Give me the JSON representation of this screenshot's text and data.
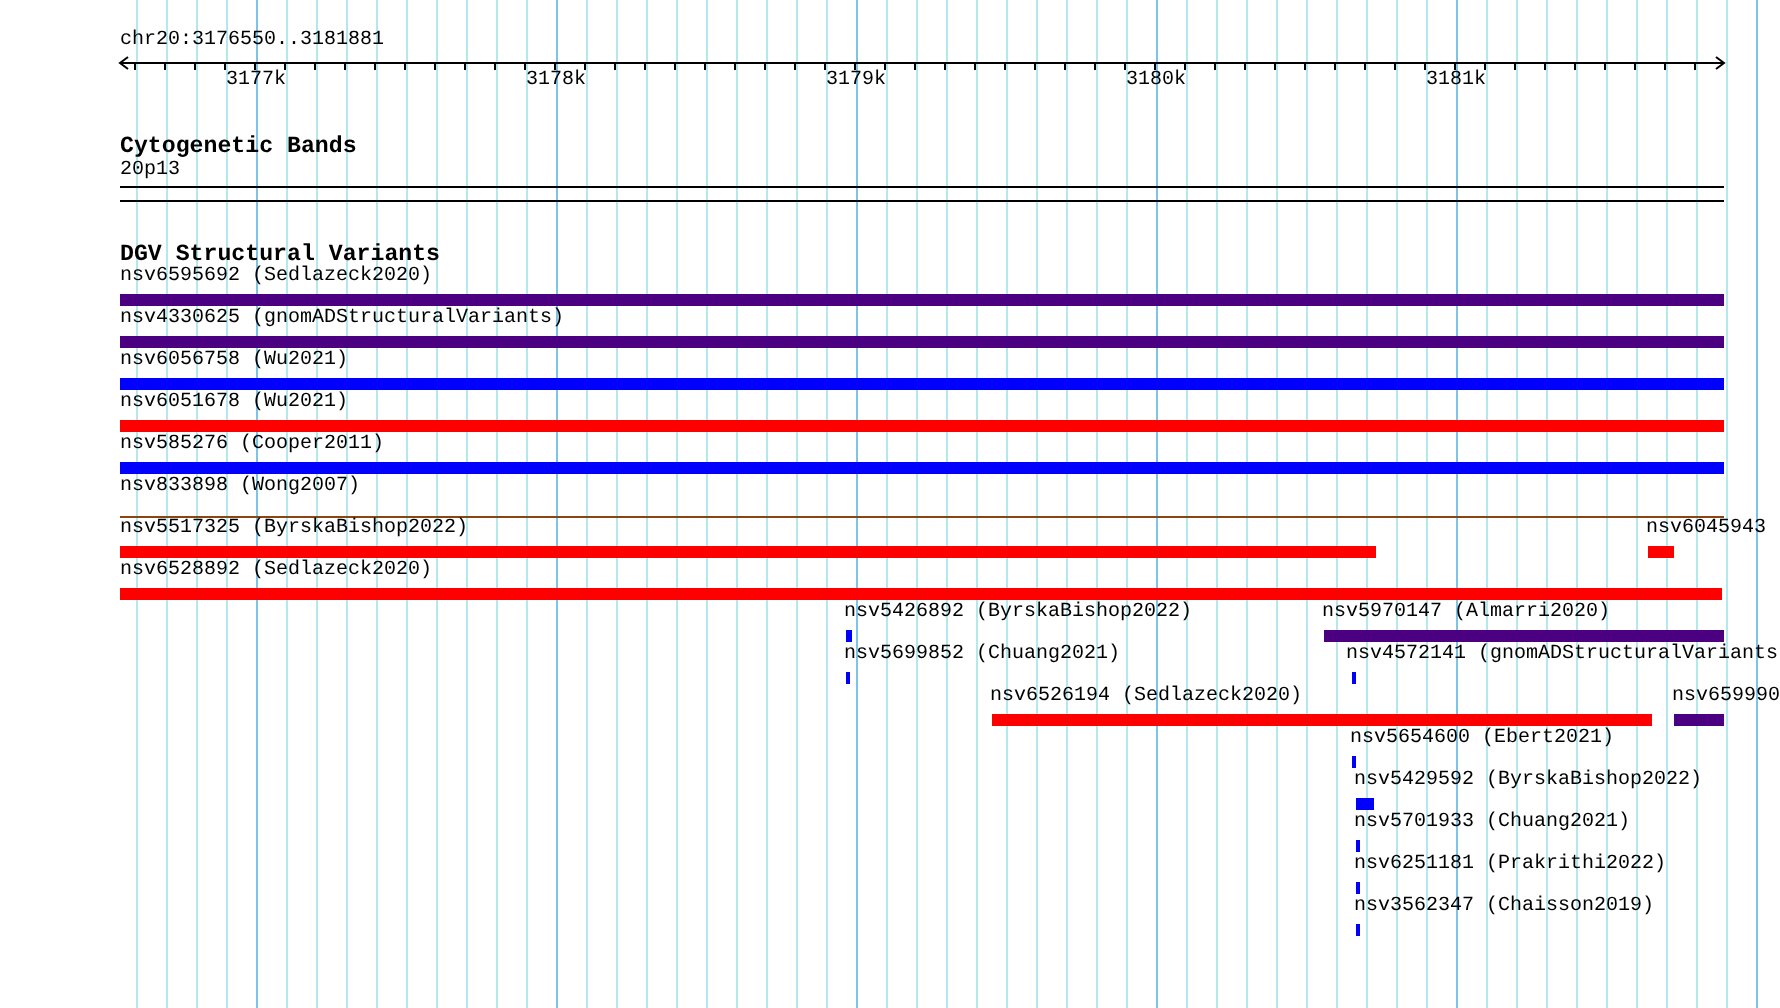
{
  "ruler": {
    "location": "chr20:3176550..3181881",
    "ticks": [
      "3177k",
      "3178k",
      "3179k",
      "3180k",
      "3181k"
    ]
  },
  "cytobands": {
    "title": "Cytogenetic Bands",
    "band": "20p13"
  },
  "variants": {
    "title": "DGV Structural Variants",
    "rows": [
      {
        "features": [
          {
            "label": "nsv6595692 (Sedlazeck2020)",
            "color": "#4b0082",
            "kind": "bar"
          }
        ]
      },
      {
        "features": [
          {
            "label": "nsv4330625 (gnomADStructuralVariants)",
            "color": "#4b0082",
            "kind": "bar"
          }
        ]
      },
      {
        "features": [
          {
            "label": "nsv6056758 (Wu2021)",
            "color": "#0000ff",
            "kind": "bar"
          }
        ]
      },
      {
        "features": [
          {
            "label": "nsv6051678 (Wu2021)",
            "color": "#ff0000",
            "kind": "bar"
          }
        ]
      },
      {
        "features": [
          {
            "label": "nsv585276 (Cooper2011)",
            "color": "#0000ff",
            "kind": "bar"
          }
        ]
      },
      {
        "features": [
          {
            "label": "nsv833898 (Wong2007)",
            "color": "#8b4513",
            "kind": "line"
          }
        ]
      },
      {
        "features": [
          {
            "label": "nsv5517325 (ByrskaBishop2022)",
            "color": "#ff0000",
            "kind": "bar"
          },
          {
            "label": "nsv6045943",
            "color": "#ff0000",
            "kind": "bar"
          }
        ]
      },
      {
        "features": [
          {
            "label": "nsv6528892 (Sedlazeck2020)",
            "color": "#ff0000",
            "kind": "bar"
          }
        ]
      },
      {
        "features": [
          {
            "label": "nsv5426892 (ByrskaBishop2022)",
            "color": "#0000ff",
            "kind": "bar"
          },
          {
            "label": "nsv5970147 (Almarri2020)",
            "color": "#4b0082",
            "kind": "bar"
          }
        ]
      },
      {
        "features": [
          {
            "label": "nsv5699852 (Chuang2021)",
            "color": "#0000ff",
            "kind": "bar"
          },
          {
            "label": "nsv4572141 (gnomADStructuralVariants",
            "color": "#0000ff",
            "kind": "bar"
          }
        ]
      },
      {
        "features": [
          {
            "label": "nsv6526194 (Sedlazeck2020)",
            "color": "#ff0000",
            "kind": "bar"
          },
          {
            "label": "nsv659990",
            "color": "#4b0082",
            "kind": "bar"
          }
        ]
      },
      {
        "features": [
          {
            "label": "nsv5654600 (Ebert2021)",
            "color": "#0000ff",
            "kind": "bar"
          }
        ]
      },
      {
        "features": [
          {
            "label": "nsv5429592 (ByrskaBishop2022)",
            "color": "#0000ff",
            "kind": "bar"
          }
        ]
      },
      {
        "features": [
          {
            "label": "nsv5701933 (Chuang2021)",
            "color": "#0000ff",
            "kind": "bar"
          }
        ]
      },
      {
        "features": [
          {
            "label": "nsv6251181 (Prakrithi2022)",
            "color": "#0000ff",
            "kind": "bar"
          }
        ]
      },
      {
        "features": [
          {
            "label": "nsv3562347 (Chaisson2019)",
            "color": "#0000ff",
            "kind": "bar"
          }
        ]
      }
    ]
  }
}
